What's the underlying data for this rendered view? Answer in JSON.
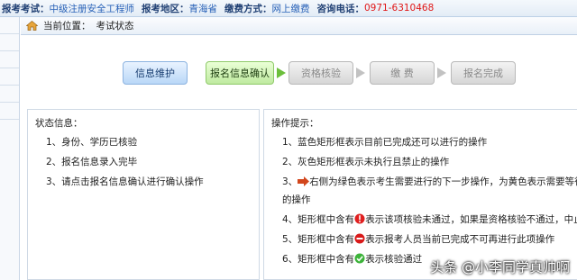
{
  "topbar": {
    "exam_type_label": "报考考试：",
    "exam_type": "中级注册安全工程师",
    "region_label": "报考地区：",
    "region": "青海省",
    "payment_label": "缴费方式：",
    "payment": "网上缴费",
    "phone_label": "咨询电话：",
    "phone": "0971-6310468"
  },
  "breadcrumb": {
    "label": "当前位置：",
    "current": "考试状态"
  },
  "steps": [
    {
      "label": "信息维护",
      "state": "blue"
    },
    {
      "label": "报名信息确认",
      "state": "green"
    },
    {
      "label": "资格核验",
      "state": "grey"
    },
    {
      "label": "缴 费",
      "state": "grey"
    },
    {
      "label": "报名完成",
      "state": "grey"
    }
  ],
  "status_panel": {
    "title": "状态信息：",
    "items": [
      "1、身份、学历已核验",
      "2、报名信息录入完毕",
      "3、请点击报名信息确认进行确认操作"
    ]
  },
  "tips_panel": {
    "title": "操作提示：",
    "tip1": "1、蓝色矩形框表示目前已完成还可以进行的操作",
    "tip2": "2、灰色矩形框表示未执行且禁止的操作",
    "tip3_prefix": "3、",
    "tip3_text": "右侧为绿色表示考生需要进行的下一步操作，为黄色表示需要等待机",
    "tip3_cont": "的操作",
    "tip4_prefix": "4、矩形框中含有",
    "tip4_text": "表示该项核验未通过，如果是资格核验不通过，中止报",
    "tip5_prefix": "5、矩形框中含有",
    "tip5_text": "表示报考人员当前已完成不可再进行此项操作",
    "tip6_prefix": "6、矩形框中含有",
    "tip6_text": "表示核验通过"
  },
  "watermark": "头条 @小李同学真帅啊",
  "colors": {
    "accent_blue": "#2a63b8",
    "phone_red": "#e01818",
    "step_green": "#6cbf3c"
  }
}
